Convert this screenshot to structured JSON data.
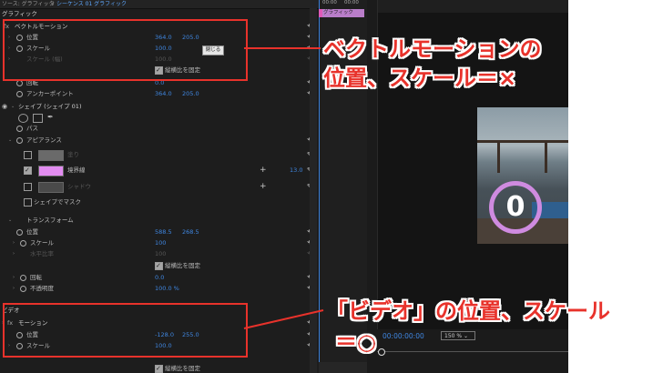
{
  "tabs": {
    "source": "ソース: グラフィック",
    "close": "v",
    "sequence": "シーケンス 01 グラフィック"
  },
  "timeline": {
    "time_a": "00:00",
    "time_b": "00:00",
    "clip_label": "グラフィック"
  },
  "graphic_panel": {
    "graphic_header": "グラフィック",
    "vector_motion": "ベクトルモーション",
    "position_label": "位置",
    "position_x": "364.0",
    "position_y": "205.0",
    "scale_label": "スケール",
    "scale_value": "100.0",
    "scale_width_label": "スケール (幅)",
    "scale_width_value": "100.0",
    "tooltip": "閉じる",
    "uniform_scale": "縦横比を固定",
    "rotation_label": "回転",
    "rotation_value": "0.0",
    "anchor_label": "アンカーポイント",
    "anchor_x": "364.0",
    "anchor_y": "205.0",
    "shape_layer": "シェイプ (シェイプ 01)",
    "path_label": "パス",
    "appearance_label": "アピアランス",
    "fill_label": "塗り",
    "stroke_label": "境界線",
    "stroke_value": "13.0",
    "shadow_label": "シャドウ",
    "mask_label": "シェイプでマスク",
    "transform_label": "トランスフォーム",
    "t_position_label": "位置",
    "t_position_x": "588.5",
    "t_position_y": "268.5",
    "t_scale_label": "スケール",
    "t_scale_value": "100",
    "t_scale_width_label": "水平比率",
    "t_scale_width_value": "100",
    "t_uniform": "縦横比を固定",
    "t_rotation_label": "回転",
    "t_rotation_value": "0.0",
    "t_opacity_label": "不透明度",
    "t_opacity_value": "100.0 %"
  },
  "video_panel": {
    "video_header": "ビデオ",
    "motion_label": "モーション",
    "position_label": "位置",
    "position_x": "-128.0",
    "position_y": "255.0",
    "scale_label": "スケール",
    "scale_value": "100.0",
    "uniform_scale": "縦横比を固定"
  },
  "monitor": {
    "counter_digit": "0",
    "timecode": "00:00:00:00",
    "zoom": "150 %"
  },
  "annotations": {
    "top_line1": "ベクトルモーションの",
    "top_line2": "位置、スケール＝×",
    "bottom_line1": "「ビデオ」の位置、スケール",
    "bottom_line2": "＝○"
  },
  "colors": {
    "annotation_red": "#e8322b",
    "value_blue": "#3f86e0",
    "stroke_pink": "#e28cf0",
    "clip_purple": "#b97dc9"
  }
}
